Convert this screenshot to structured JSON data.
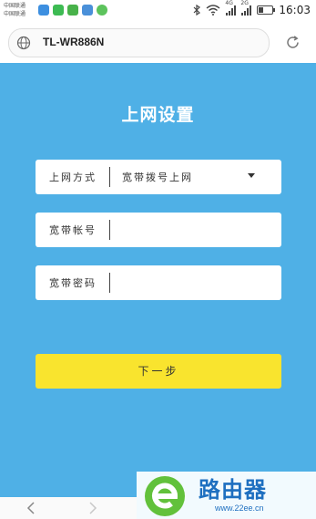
{
  "status_bar": {
    "carrier_line1": "中国联通",
    "carrier_line2": "中国联通",
    "signal1_label": "4G",
    "signal2_label": "2G",
    "time": "16:03"
  },
  "browser": {
    "url": "TL-WR886N"
  },
  "page": {
    "title": "上网设置",
    "connection_type_label": "上网方式",
    "connection_type_value": "宽带拨号上网",
    "account_label": "宽带帐号",
    "account_value": "",
    "password_label": "宽带密码",
    "password_value": "",
    "next_button": "下一步"
  },
  "watermark": {
    "text": "路由器",
    "url": "www.22ee.cn"
  },
  "colors": {
    "page_background": "#4fb0e6",
    "button_yellow": "#f9e42e",
    "watermark_blue": "#1e6fc0",
    "watermark_green": "#62c13b"
  },
  "icons": [
    "wifi-icon",
    "bluetooth-icon",
    "battery-icon",
    "globe-icon",
    "reload-icon",
    "back-icon",
    "forward-icon"
  ]
}
